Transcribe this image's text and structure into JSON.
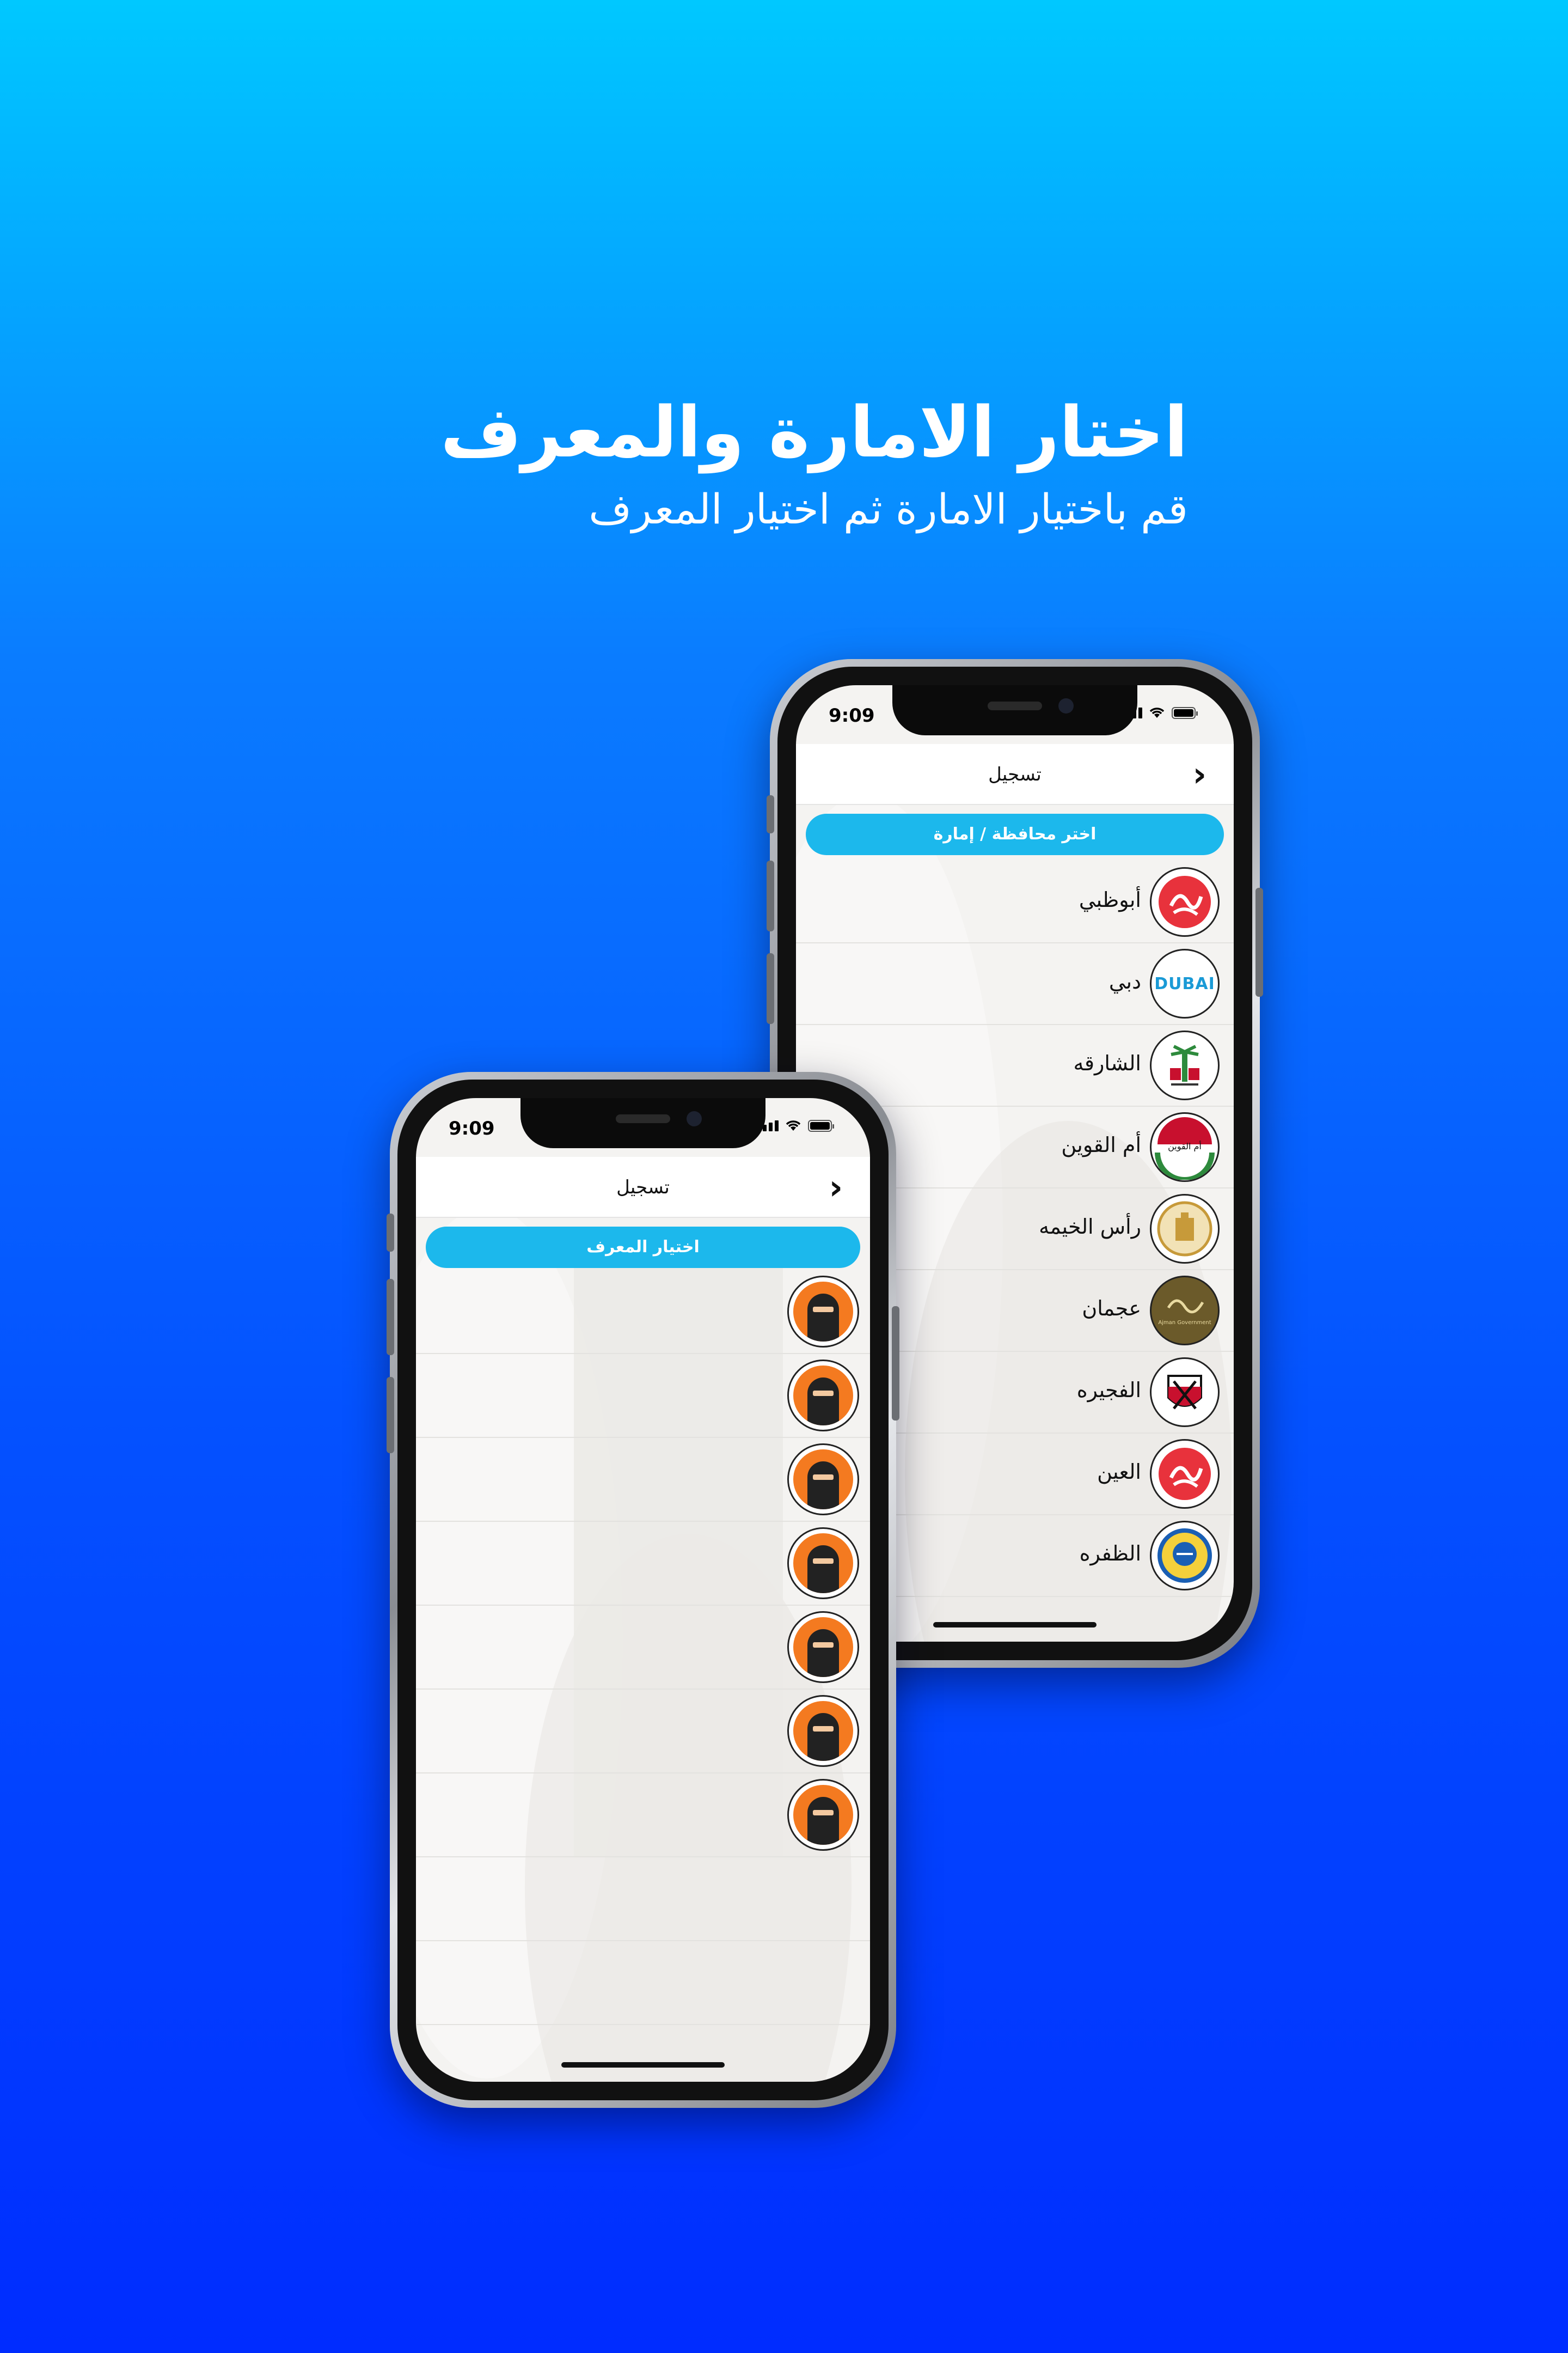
{
  "headline": {
    "title": "اختار الامارة والمعرف",
    "subtitle": "قم باختيار الامارة ثم اختيار المعرف"
  },
  "back_phone": {
    "status_time": "9:09",
    "appbar_title": "تسجيل",
    "pill_label": "اختر محافظة / إمارة",
    "emirates": [
      {
        "name": "أبوظبي",
        "logo": "abudhabi-logo"
      },
      {
        "name": "دبي",
        "logo": "dubai-logo",
        "logo_text": "DUBAI"
      },
      {
        "name": "الشارقه",
        "logo": "sharjah-logo"
      },
      {
        "name": "أم القوين",
        "logo": "ummalquwain-logo",
        "logo_text": "أم القوين"
      },
      {
        "name": "رأس الخيمه",
        "logo": "rasalkhaimah-logo"
      },
      {
        "name": "عجمان",
        "logo": "ajman-logo",
        "logo_text": "Ajman Government"
      },
      {
        "name": "الفجيره",
        "logo": "fujairah-logo"
      },
      {
        "name": "العين",
        "logo": "alain-logo"
      },
      {
        "name": "الظفره",
        "logo": "aldhafra-logo"
      }
    ]
  },
  "front_phone": {
    "status_time": "9:09",
    "appbar_title": "تسجيل",
    "pill_label": "اختيار المعرف",
    "avatars": [
      "avatar-1",
      "avatar-2",
      "avatar-3",
      "avatar-4",
      "avatar-5",
      "avatar-6",
      "avatar-7"
    ]
  },
  "colors": {
    "accent": "#1cb8ec",
    "bg_top": "#00c8ff",
    "bg_bottom": "#002cff",
    "avatar_orange": "#f47a20"
  }
}
